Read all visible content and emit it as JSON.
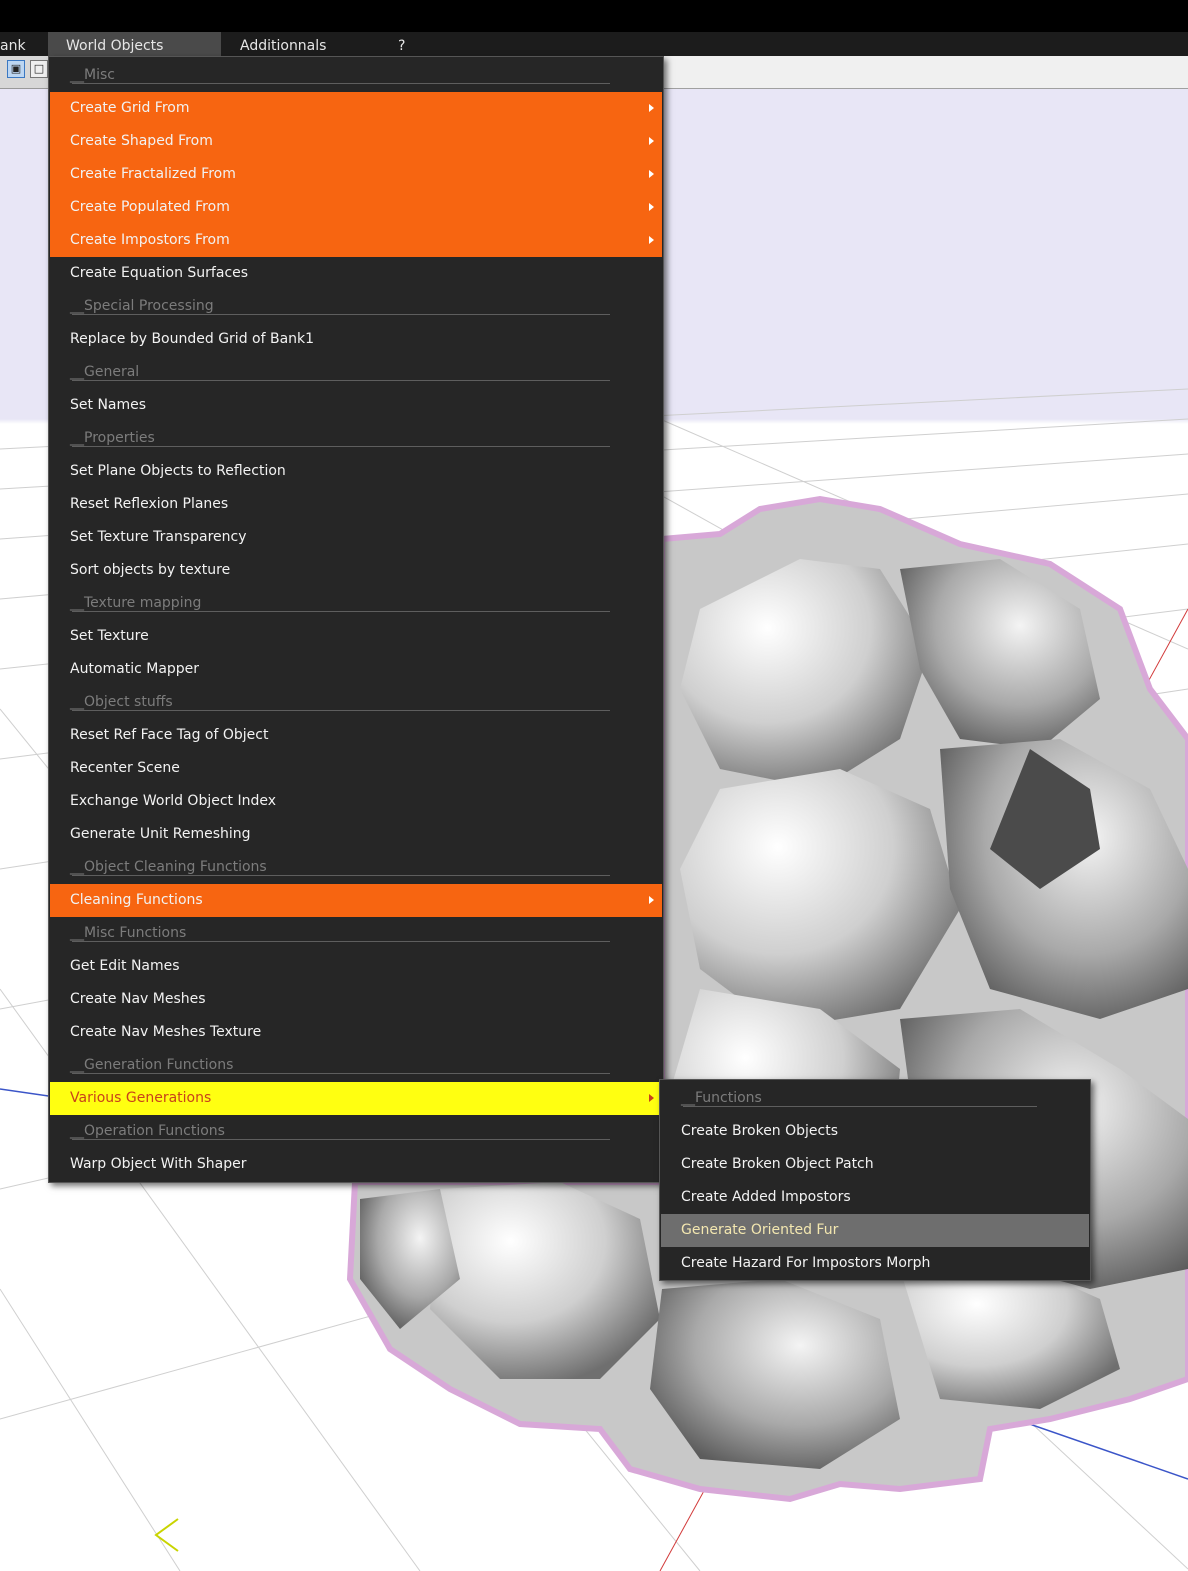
{
  "menubar": {
    "items": [
      {
        "label": "ank"
      },
      {
        "label": "World Objects"
      },
      {
        "label": "Additionnals"
      },
      {
        "label": "?"
      }
    ]
  },
  "menu": {
    "rows": [
      {
        "type": "separator",
        "label": "__Misc"
      },
      {
        "type": "submenu",
        "label": "Create Grid From"
      },
      {
        "type": "submenu",
        "label": "Create Shaped From"
      },
      {
        "type": "submenu",
        "label": "Create Fractalized From"
      },
      {
        "type": "submenu",
        "label": "Create Populated From"
      },
      {
        "type": "submenu",
        "label": "Create Impostors From"
      },
      {
        "type": "item",
        "label": "Create Equation Surfaces"
      },
      {
        "type": "separator",
        "label": "__Special Processing"
      },
      {
        "type": "item",
        "label": "Replace by Bounded Grid of Bank1"
      },
      {
        "type": "separator",
        "label": "__General"
      },
      {
        "type": "item",
        "label": "Set Names"
      },
      {
        "type": "separator",
        "label": "__Properties"
      },
      {
        "type": "item",
        "label": "Set Plane Objects to Reflection"
      },
      {
        "type": "item",
        "label": "Reset Reflexion Planes"
      },
      {
        "type": "item",
        "label": "Set Texture Transparency"
      },
      {
        "type": "item",
        "label": "Sort objects by texture"
      },
      {
        "type": "separator",
        "label": "__Texture mapping"
      },
      {
        "type": "item",
        "label": "Set Texture"
      },
      {
        "type": "item",
        "label": "Automatic Mapper"
      },
      {
        "type": "separator",
        "label": "__Object stuffs"
      },
      {
        "type": "item",
        "label": "Reset Ref Face Tag of Object"
      },
      {
        "type": "item",
        "label": "Recenter Scene"
      },
      {
        "type": "item",
        "label": "Exchange World Object Index"
      },
      {
        "type": "item",
        "label": "Generate Unit Remeshing"
      },
      {
        "type": "separator",
        "label": "__Object Cleaning Functions"
      },
      {
        "type": "submenu",
        "label": "Cleaning Functions"
      },
      {
        "type": "separator",
        "label": "__Misc Functions"
      },
      {
        "type": "item",
        "label": "Get Edit Names"
      },
      {
        "type": "item",
        "label": "Create Nav Meshes"
      },
      {
        "type": "item",
        "label": "Create Nav Meshes Texture"
      },
      {
        "type": "separator",
        "label": "__Generation Functions"
      },
      {
        "type": "submenu-open",
        "label": "Various Generations"
      },
      {
        "type": "separator",
        "label": "__Operation Functions"
      },
      {
        "type": "item",
        "label": "Warp Object With Shaper"
      }
    ]
  },
  "submenu": {
    "rows": [
      {
        "type": "separator",
        "label": "__Functions"
      },
      {
        "type": "item",
        "label": "Create Broken Objects"
      },
      {
        "type": "item",
        "label": "Create Broken Object Patch"
      },
      {
        "type": "item",
        "label": "Create Added Impostors"
      },
      {
        "type": "hover",
        "label": "Generate Oriented Fur"
      },
      {
        "type": "item",
        "label": "Create Hazard For Impostors Morph"
      }
    ]
  },
  "toolbar": {
    "buttons": [
      {
        "icon": "cube-icon",
        "selected": true
      },
      {
        "icon": "cube-outline-icon",
        "selected": false
      }
    ]
  },
  "colors": {
    "submenu_highlight": "#f76511",
    "open_submenu": "#ffff11",
    "open_submenu_text": "#c8421a",
    "menu_bg": "#262626",
    "separator_text": "#7c7c7c",
    "mesh_outline": "#d8a8d8"
  }
}
